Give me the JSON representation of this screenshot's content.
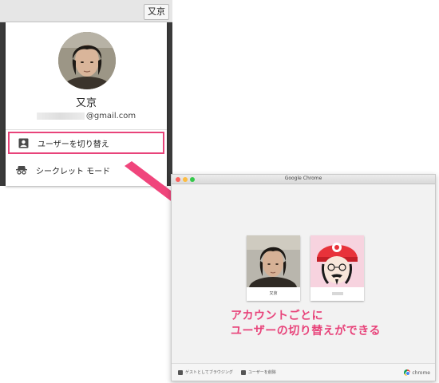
{
  "profile_menu": {
    "name_chip": "又京",
    "user_name": "又京",
    "email_suffix": "@gmail.com",
    "switch_user_label": "ユーザーを切り替え",
    "incognito_label": "シークレット モード"
  },
  "chrome_window": {
    "title": "Google Chrome",
    "cards": [
      {
        "name": "又京"
      },
      {
        "name": ""
      }
    ],
    "caption_line1": "アカウントごとに",
    "caption_line2": "ユーザーの切り替えができる",
    "footer": {
      "guest_label": "ゲストとしてブラウジング",
      "remove_label": "ユーザーを削除",
      "brand": "chrome"
    }
  },
  "colors": {
    "highlight": "#e8437a",
    "arrow": "#f0457c"
  }
}
